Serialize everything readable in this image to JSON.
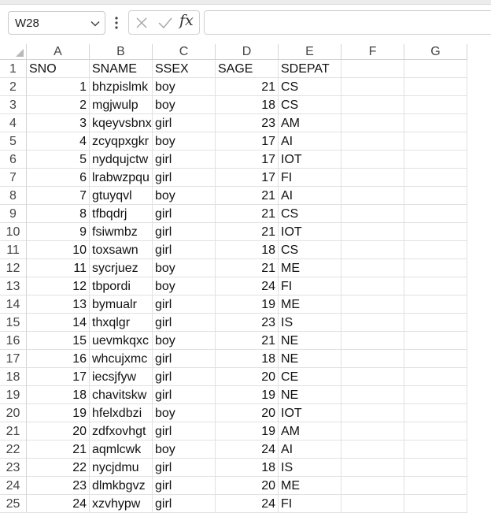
{
  "name_box": {
    "value": "W28",
    "dropdown_icon": "chevron-down-icon"
  },
  "formula_bar": {
    "more_icon": "vertical-ellipsis-icon",
    "cancel_icon": "close-icon",
    "enter_icon": "checkmark-icon",
    "function_label": "fx",
    "content": ""
  },
  "columns": [
    "A",
    "B",
    "C",
    "D",
    "E",
    "F",
    "G"
  ],
  "header_row": [
    "SNO",
    "SNAME",
    "SSEX",
    "SAGE",
    "SDEPAT"
  ],
  "rows": [
    {
      "n": "1",
      "a": "SNO",
      "b": "SNAME",
      "c": "SSEX",
      "d": "SAGE",
      "e": "SDEPAT"
    },
    {
      "n": "2",
      "a": "1",
      "b": "bhzpislmk",
      "c": "boy",
      "d": "21",
      "e": "CS"
    },
    {
      "n": "3",
      "a": "2",
      "b": "mgjwulp",
      "c": "boy",
      "d": "18",
      "e": "CS"
    },
    {
      "n": "4",
      "a": "3",
      "b": "kqeyvsbnx",
      "c": "girl",
      "d": "23",
      "e": "AM"
    },
    {
      "n": "5",
      "a": "4",
      "b": "zcyqpxgkr",
      "c": "boy",
      "d": "17",
      "e": "AI"
    },
    {
      "n": "6",
      "a": "5",
      "b": "nydqujctw",
      "c": "girl",
      "d": "17",
      "e": "IOT"
    },
    {
      "n": "7",
      "a": "6",
      "b": "lrabwzpqu",
      "c": "girl",
      "d": "17",
      "e": "FI"
    },
    {
      "n": "8",
      "a": "7",
      "b": "gtuyqvl",
      "c": "boy",
      "d": "21",
      "e": "AI"
    },
    {
      "n": "9",
      "a": "8",
      "b": "tfbqdrj",
      "c": "girl",
      "d": "21",
      "e": "CS"
    },
    {
      "n": "10",
      "a": "9",
      "b": "fsiwmbz",
      "c": "girl",
      "d": "21",
      "e": "IOT"
    },
    {
      "n": "11",
      "a": "10",
      "b": "toxsawn",
      "c": "girl",
      "d": "18",
      "e": "CS"
    },
    {
      "n": "12",
      "a": "11",
      "b": "sycrjuez",
      "c": "boy",
      "d": "21",
      "e": "ME"
    },
    {
      "n": "13",
      "a": "12",
      "b": "tbpordi",
      "c": "boy",
      "d": "24",
      "e": "FI"
    },
    {
      "n": "14",
      "a": "13",
      "b": "bymualr",
      "c": "girl",
      "d": "19",
      "e": "ME"
    },
    {
      "n": "15",
      "a": "14",
      "b": "thxqlgr",
      "c": "girl",
      "d": "23",
      "e": "IS"
    },
    {
      "n": "16",
      "a": "15",
      "b": "uevmkqxc",
      "c": "boy",
      "d": "21",
      "e": "NE"
    },
    {
      "n": "17",
      "a": "16",
      "b": "whcujxmc",
      "c": "girl",
      "d": "18",
      "e": "NE"
    },
    {
      "n": "18",
      "a": "17",
      "b": "iecsjfyw",
      "c": "girl",
      "d": "20",
      "e": "CE"
    },
    {
      "n": "19",
      "a": "18",
      "b": "chavitskw",
      "c": "girl",
      "d": "19",
      "e": "NE"
    },
    {
      "n": "20",
      "a": "19",
      "b": "hfelxdbzi",
      "c": "boy",
      "d": "20",
      "e": "IOT"
    },
    {
      "n": "21",
      "a": "20",
      "b": "zdfxovhgt",
      "c": "girl",
      "d": "19",
      "e": "AM"
    },
    {
      "n": "22",
      "a": "21",
      "b": "aqmlcwk",
      "c": "boy",
      "d": "24",
      "e": "AI"
    },
    {
      "n": "23",
      "a": "22",
      "b": "nycjdmu",
      "c": "girl",
      "d": "18",
      "e": "IS"
    },
    {
      "n": "24",
      "a": "23",
      "b": "dlmkbgvz",
      "c": "girl",
      "d": "20",
      "e": "ME"
    },
    {
      "n": "25",
      "a": "24",
      "b": "xzvhypw",
      "c": "girl",
      "d": "24",
      "e": "FI"
    }
  ],
  "colors": {
    "grid": "#e1e1e1",
    "header_border": "#d4d4d4",
    "text": "#111111"
  }
}
